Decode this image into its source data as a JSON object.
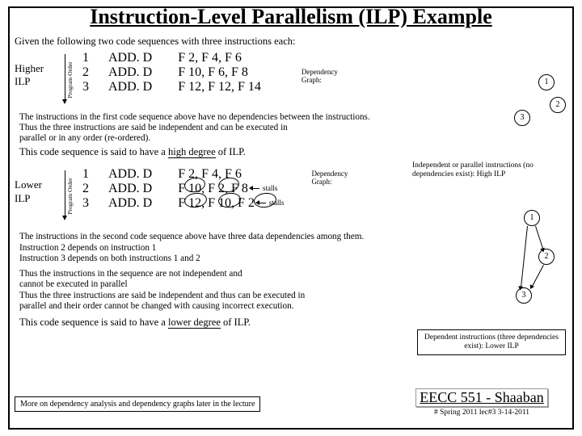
{
  "title": "Instruction-Level Parallelism (ILP) Example",
  "intro": "Given the following two code sequences with three instructions each:",
  "prog_order_label": "Program  Order",
  "higher": {
    "label_l1": "Higher",
    "label_l2": "ILP"
  },
  "lower": {
    "label_l1": "Lower",
    "label_l2": "ILP"
  },
  "dep_graph_label_l1": "Dependency",
  "dep_graph_label_l2": "Graph:",
  "stalls_label": "stalls",
  "seq1": {
    "rows": [
      {
        "n": "1",
        "op": "ADD. D",
        "args": "F 2, F 4, F 6"
      },
      {
        "n": "2",
        "op": "ADD. D",
        "args": "F 10, F 6, F 8"
      },
      {
        "n": "3",
        "op": "ADD. D",
        "args": "F 12, F 12, F 14"
      }
    ]
  },
  "seq2": {
    "rows": [
      {
        "n": "1",
        "op": "ADD. D",
        "args": "F 2, F 4, F 6"
      },
      {
        "n": "2",
        "op": "ADD. D",
        "args": "F 10, F 2, F 8"
      },
      {
        "n": "3",
        "op": "ADD. D",
        "args": "F 12, F 10, F 2"
      }
    ]
  },
  "para1_l1": "The instructions in the first code sequence above have no dependencies between the instructions.",
  "para1_l2": "Thus the three instructions are said be independent and can be executed in",
  "para1_l3": "parallel or in any order (re-ordered).",
  "para1_emph_a": "This code sequence is said to have a ",
  "para1_emph_b": "high degree",
  "para1_emph_c": " of ILP.",
  "sidecap1": "Independent or parallel instructions (no dependencies exist): High ILP",
  "para2_l1": "The instructions in the second code sequence above have three data dependencies among them.",
  "para2_l2": "Instruction 2 depends on instruction 1",
  "para2_l3": "Instruction 3 depends on both instructions 1 and 2",
  "para2_b1": "Thus the instructions in the sequence are not independent and",
  "para2_b2": "cannot be executed in parallel",
  "para2_b3": "Thus the three instructions are said be independent and thus can be executed in",
  "para2_b4": "parallel and their order cannot be changed with causing incorrect execution.",
  "para2_emph_a": "This code sequence is said to have a ",
  "para2_emph_b": "lower degree",
  "para2_emph_c": " of ILP.",
  "sidecap2": "Dependent instructions (three dependencies exist): Lower ILP",
  "footer_note": "More on dependency analysis and dependency graphs later in the lecture",
  "course_title": "EECC 551 - Shaaban",
  "course_sub": "#  Spring 2011  lec#3   3-14-2011",
  "nodes": {
    "n1": "1",
    "n2": "2",
    "n3": "3"
  }
}
